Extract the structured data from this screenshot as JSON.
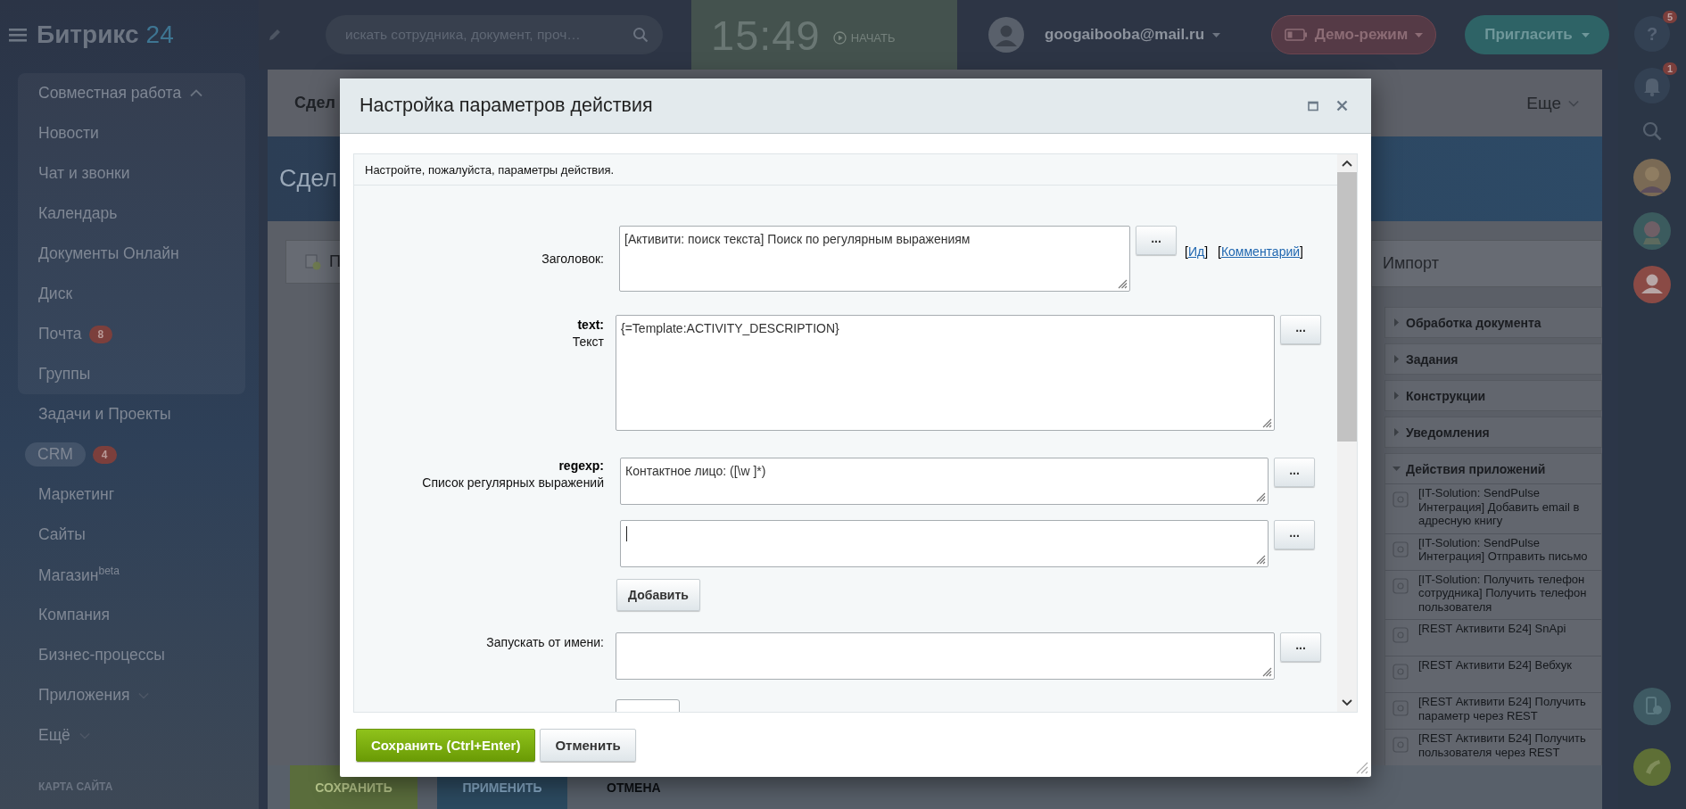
{
  "header": {
    "logo": {
      "name": "Битрикс",
      "number": "24"
    },
    "search": {
      "placeholder": "искать сотрудника, документ, проч…"
    },
    "clock": {
      "time": "15:49",
      "start": "НАЧАТЬ"
    },
    "user": {
      "email": "googaibooba@mail.ru"
    },
    "demo_button": "Демо-режим",
    "invite_button": "Пригласить"
  },
  "sidebar": {
    "items": [
      {
        "label": "Совместная работа",
        "selected": false,
        "expanded": true,
        "children": [
          {
            "label": "Новости",
            "selected": false
          },
          {
            "label": "Чат и звонки",
            "selected": false
          },
          {
            "label": "Календарь",
            "selected": false
          },
          {
            "label": "Документы Онлайн",
            "selected": false
          },
          {
            "label": "Диск",
            "selected": false
          },
          {
            "label": "Почта",
            "selected": false,
            "counter": "8"
          },
          {
            "label": "Группы",
            "selected": false
          }
        ]
      },
      {
        "label": "Задачи и Проекты",
        "selected": false
      },
      {
        "label": "CRM",
        "selected": true,
        "counter": "4"
      },
      {
        "label": "Маркетинг",
        "selected": false
      },
      {
        "label": "Сайты",
        "selected": false
      },
      {
        "label": "Магазин$^{beta}$",
        "selected": false
      },
      {
        "label": "Компания",
        "selected": false
      },
      {
        "label": "Бизнес-процессы",
        "selected": false
      },
      {
        "label": "Приложения",
        "selected": false,
        "expanded": false
      },
      {
        "label": "Ещё",
        "selected": false,
        "expanded": false
      }
    ],
    "sitemap_link": "КАРТА САЙТА"
  },
  "page": {
    "tab": "Сдел",
    "more": "Еще",
    "title": "Сдел",
    "toolbar_button": "П",
    "import_button": "Импорт",
    "sections": [
      {
        "title": "Обработка документа",
        "expanded": false
      },
      {
        "title": "Задания",
        "expanded": false
      },
      {
        "title": "Конструкции",
        "expanded": false
      },
      {
        "title": "Уведомления",
        "expanded": false
      },
      {
        "title": "Действия приложений",
        "expanded": true,
        "items": [
          "[IT-Solution: SendPulse Интеграция] Добавить email в адресную книгу",
          "[IT-Solution: SendPulse Интеграция] Отправить письмо",
          "[IT-Solution: Получить телефон сотрудника] Получить телефон пользователя",
          "[REST Активити Б24] SnApi",
          "[REST Активити Б24] Вебхук",
          "[REST Активити Б24] Получить параметр через REST",
          "[REST Активити Б24] Получить пользователя через REST"
        ]
      }
    ],
    "actions": [
      {
        "label": "СОХРАНИТЬ",
        "kind": "save"
      },
      {
        "label": "ПРИМЕНИТЬ",
        "kind": "apply"
      },
      {
        "label": "ОТМЕНА",
        "kind": "cancel"
      }
    ]
  },
  "right_bar": {
    "help_button": "?",
    "help_badge": "5",
    "notifications_badge": "1"
  },
  "dialog": {
    "title": "Настройка параметров действия",
    "intro": "Настройте, пожалуйста, параметры действия.",
    "fields": [
      {
        "kind": "title",
        "label": "Заголовок:",
        "value": "[Активити: поиск текста] Поиск по регулярным выражениям",
        "button": "...",
        "links": [
          {
            "before": "[",
            "label": "Ид",
            "after": "]"
          },
          {
            "before": "[",
            "label": "Комментарий",
            "after": "]"
          }
        ]
      },
      {
        "kind": "text",
        "name": "text:",
        "label": "Текст",
        "value": "{=Template:ACTIVITY_DESCRIPTION}",
        "button": "..."
      },
      {
        "kind": "list",
        "name": "regexp:",
        "label": "Список регулярных выражений",
        "entries": [
          {
            "value": "Контактное лицо: ([\\w ]*)",
            "focused": false,
            "button": "..."
          },
          {
            "focused": true,
            "button": "..."
          }
        ],
        "add_button": "Добавить"
      },
      {
        "kind": "user",
        "label": "Запускать от имени:",
        "button": "..."
      }
    ],
    "buttons": [
      {
        "label": "Сохранить (Ctrl+Enter)",
        "kind": "primary"
      },
      {
        "label": "Отменить",
        "kind": "secondary"
      }
    ]
  }
}
